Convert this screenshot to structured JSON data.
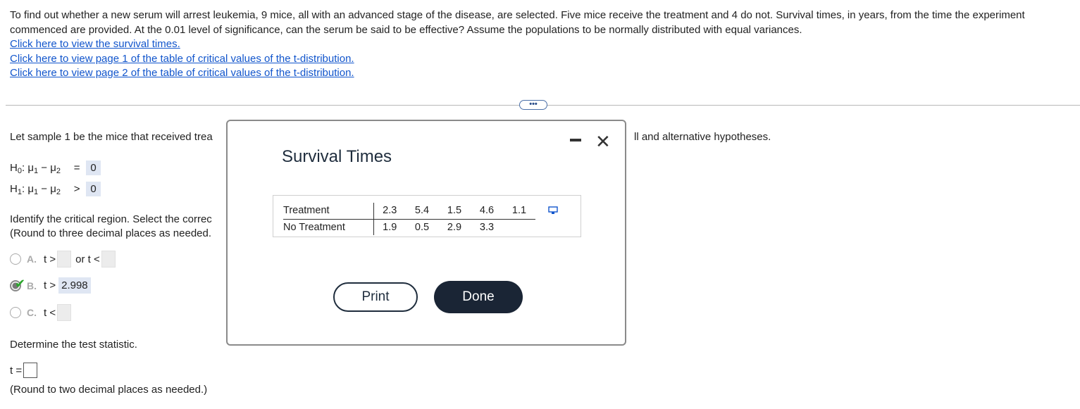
{
  "problem": {
    "text": "To find out whether a new serum will arrest leukemia, 9 mice, all with an advanced stage of the disease, are selected. Five mice receive the treatment and 4 do not. Survival times, in years, from the time the experiment commenced are provided. At the 0.01 level of significance, can the serum be said to be effective? Assume the populations to be normally distributed with equal variances.",
    "links": [
      "Click here to view the survival times.",
      "Click here to view page 1 of the table of critical values of the t-distribution.",
      "Click here to view page 2 of the table of critical values of the t-distribution."
    ]
  },
  "more_button": "•••",
  "work": {
    "intro_visible": "Let sample 1 be the mice that received trea",
    "intro_tail": "ll and alternative hypotheses.",
    "h0": {
      "label": "H",
      "sub0": "0",
      "mu1": "μ",
      "s1": "1",
      "minus": " − ",
      "mu2": "μ",
      "s2": "2",
      "op": "=",
      "value": "0"
    },
    "h1": {
      "label": "H",
      "sub0": "1",
      "mu1": "μ",
      "s1": "1",
      "minus": " − ",
      "mu2": "μ",
      "s2": "2",
      "op": ">",
      "value": "0"
    },
    "identify_line1": "Identify the critical region. Select the correc",
    "identify_line2": "(Round to three decimal places as needed.",
    "options": [
      {
        "letter": "A.",
        "pre": "t >",
        "mid": "or t <",
        "checked": false
      },
      {
        "letter": "B.",
        "pre": "t >",
        "answer": "2.998",
        "checked": true
      },
      {
        "letter": "C.",
        "pre": "t <",
        "checked": false
      }
    ],
    "determine": "Determine the test statistic.",
    "t_label": "t =",
    "round2": "(Round to two decimal places as needed.)"
  },
  "modal": {
    "title": "Survival Times",
    "rows": [
      {
        "label": "Treatment",
        "values": [
          "2.3",
          "5.4",
          "1.5",
          "4.6",
          "1.1"
        ]
      },
      {
        "label": "No Treatment",
        "values": [
          "1.9",
          "0.5",
          "2.9",
          "3.3"
        ]
      }
    ],
    "print_label": "Print",
    "done_label": "Done"
  }
}
